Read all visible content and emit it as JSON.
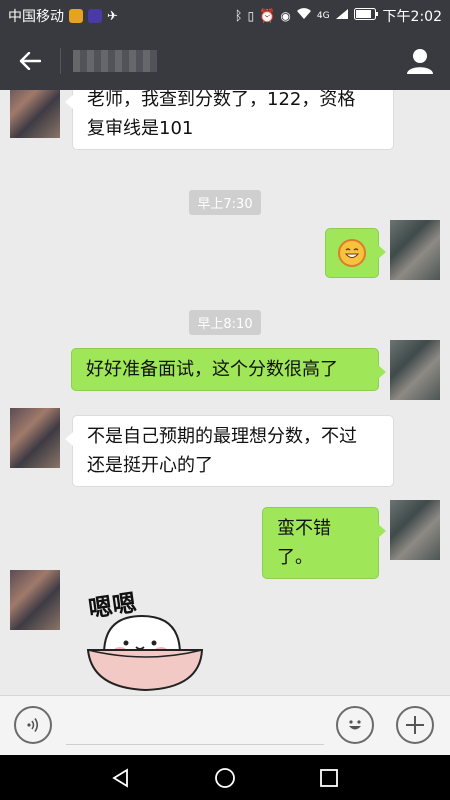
{
  "status_bar": {
    "carrier": "中国移动",
    "network": "4G",
    "time": "下午2:02"
  },
  "header": {
    "contact_name": ""
  },
  "messages": [
    {
      "side": "left",
      "type": "text",
      "text_lines": [
        "老师，我查到分数了，122，资格",
        "复审线是101"
      ]
    },
    {
      "type": "time",
      "text": "早上7:30"
    },
    {
      "side": "right",
      "type": "emoji",
      "icon": "smiling-face-emoji-icon"
    },
    {
      "type": "time",
      "text": "早上8:10"
    },
    {
      "side": "right",
      "type": "text",
      "text_lines": [
        "好好准备面试，这个分数很高了"
      ]
    },
    {
      "side": "left",
      "type": "text",
      "text_lines": [
        "不是自己预期的最理想分数，不过",
        "还是挺开心的了"
      ]
    },
    {
      "side": "right",
      "type": "text",
      "text_lines": [
        "蛮不错了。"
      ]
    },
    {
      "side": "left",
      "type": "sticker",
      "caption": "嗯嗯"
    }
  ],
  "colors": {
    "header_bg": "#393a3f",
    "chat_bg": "#ebebeb",
    "sent_bubble": "#9fe658",
    "received_bubble": "#ffffff"
  }
}
